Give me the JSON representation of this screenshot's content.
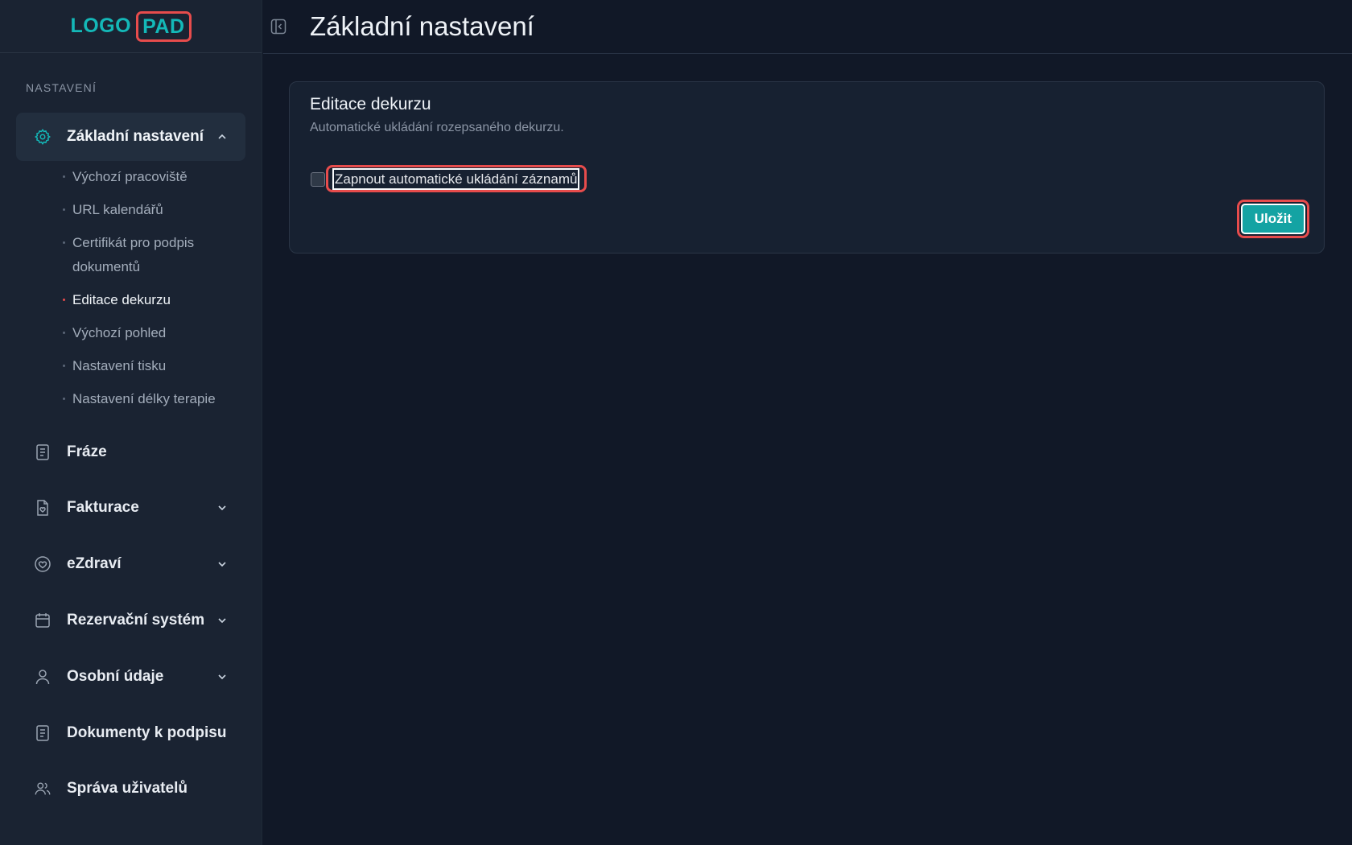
{
  "logo": {
    "part1": "LOGO",
    "part2": "PAD"
  },
  "header": {
    "title": "Základní nastavení"
  },
  "sidebar": {
    "section_label": "NASTAVENÍ",
    "active_item": {
      "label": "Základní nastavení",
      "icon": "gear-icon"
    },
    "sub_items": [
      {
        "label": "Výchozí pracoviště"
      },
      {
        "label": "URL kalendářů"
      },
      {
        "label": "Certifikát pro podpis dokumentů"
      },
      {
        "label": "Editace dekurzu",
        "active": true
      },
      {
        "label": "Výchozí pohled"
      },
      {
        "label": "Nastavení tisku"
      },
      {
        "label": "Nastavení délky terapie"
      }
    ],
    "items": [
      {
        "label": "Fráze",
        "icon": "document-icon"
      },
      {
        "label": "Fakturace",
        "icon": "invoice-icon"
      },
      {
        "label": "eZdraví",
        "icon": "heart-icon"
      },
      {
        "label": "Rezervační systém",
        "icon": "calendar-icon"
      },
      {
        "label": "Osobní údaje",
        "icon": "user-icon"
      },
      {
        "label": "Dokumenty k podpisu",
        "icon": "document-icon"
      },
      {
        "label": "Správa uživatelů",
        "icon": "users-icon"
      }
    ]
  },
  "card": {
    "title": "Editace dekurzu",
    "subtitle": "Automatické ukládání rozepsaného dekurzu.",
    "checkbox_label": "Zapnout automatické ukládání záznamů",
    "checkbox_checked": false,
    "save_label": "Uložit"
  },
  "colors": {
    "accent": "#14a3a3",
    "highlight": "#e74c4c",
    "background": "#111827",
    "sidebar": "#1a2332"
  }
}
